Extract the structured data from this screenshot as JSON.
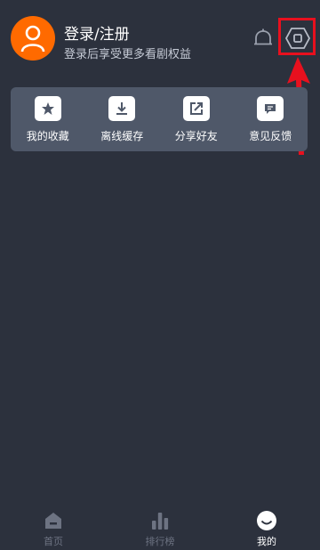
{
  "user": {
    "title": "登录/注册",
    "subtitle": "登录后享受更多看剧权益"
  },
  "header_icons": {
    "bell": "bell-icon",
    "settings": "hexagon-settings-icon"
  },
  "quick_actions": [
    {
      "label": "我的收藏",
      "icon": "star-icon"
    },
    {
      "label": "离线缓存",
      "icon": "download-icon"
    },
    {
      "label": "分享好友",
      "icon": "share-icon"
    },
    {
      "label": "意见反馈",
      "icon": "feedback-icon"
    }
  ],
  "tabbar": [
    {
      "label": "首页",
      "icon": "home-icon",
      "active": false
    },
    {
      "label": "排行榜",
      "icon": "ranking-icon",
      "active": false
    },
    {
      "label": "我的",
      "icon": "profile-icon",
      "active": true
    }
  ],
  "colors": {
    "background": "#2c313d",
    "card": "#4f5869",
    "avatar": "#ff6a00",
    "annotation": "#e8101e",
    "inactive_tab": "#6d7382"
  }
}
